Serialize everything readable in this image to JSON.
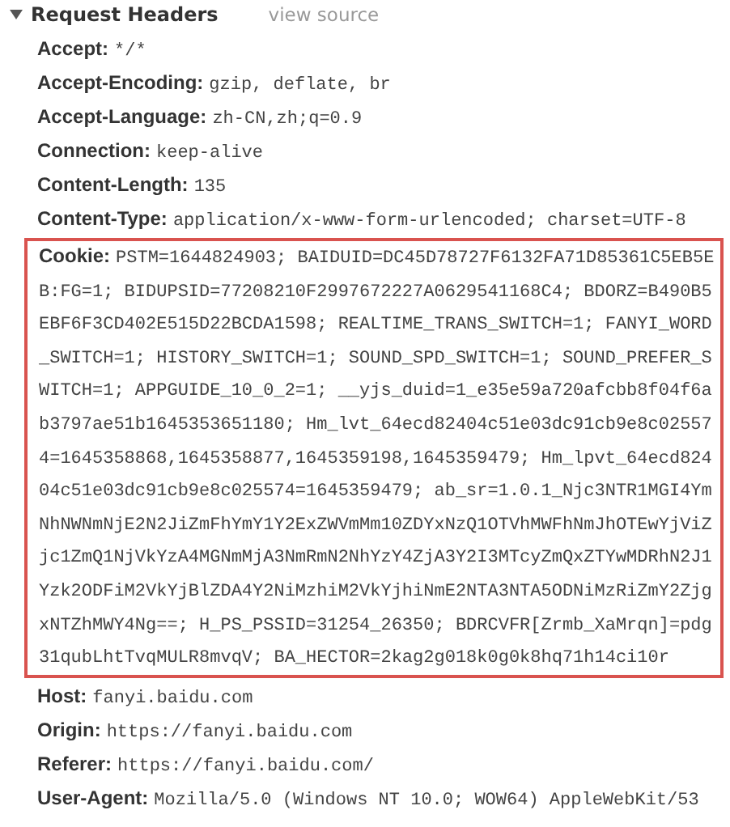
{
  "section": {
    "title": "Request Headers",
    "expanded": true,
    "link": "view source"
  },
  "headers": [
    {
      "name": "Accept:",
      "value": "*/*",
      "highlighted": false
    },
    {
      "name": "Accept-Encoding:",
      "value": "gzip, deflate, br",
      "highlighted": false
    },
    {
      "name": "Accept-Language:",
      "value": "zh-CN,zh;q=0.9",
      "highlighted": false
    },
    {
      "name": "Connection:",
      "value": "keep-alive",
      "highlighted": false
    },
    {
      "name": "Content-Length:",
      "value": "135",
      "highlighted": false
    },
    {
      "name": "Content-Type:",
      "value": "application/x-www-form-urlencoded; charset=UTF-8",
      "highlighted": false
    },
    {
      "name": "Cookie:",
      "value": "PSTM=1644824903; BAIDUID=DC45D78727F6132FA71D85361C5EB5EB:FG=1; BIDUPSID=77208210F2997672227A0629541168C4; BDORZ=B490B5EBF6F3CD402E515D22BCDA1598; REALTIME_TRANS_SWITCH=1; FANYI_WORD_SWITCH=1; HISTORY_SWITCH=1; SOUND_SPD_SWITCH=1; SOUND_PREFER_SWITCH=1; APPGUIDE_10_0_2=1; __yjs_duid=1_e35e59a720afcbb8f04f6ab3797ae51b1645353651180; Hm_lvt_64ecd82404c51e03dc91cb9e8c025574=1645358868,1645358877,1645359198,1645359479; Hm_lpvt_64ecd82404c51e03dc91cb9e8c025574=1645359479; ab_sr=1.0.1_Njc3NTR1MGI4YmNhNWNmNjE2N2JiZmFhYmY1Y2ExZWVmMm10ZDYxNzQ1OTVhMWFhNmJhOTEwYjViZjc1ZmQ1NjVkYzA4MGNmMjA3NmRmN2NhYzY4ZjA3Y2I3MTcyZmQxZTYwMDRhN2J1Yzk2ODFiM2VkYjBlZDA4Y2NiMzhiM2VkYjhiNmE2NTA3NTA5ODNiMzRiZmY2ZjgxNTZhMWY4Ng==; H_PS_PSSID=31254_26350; BDRCVFR[Zrmb_XaMrqn]=pdg31qubLhtTvqMULR8mvqV; BA_HECTOR=2kag2g018k0g0k8hq71h14ci10r",
      "highlighted": true
    },
    {
      "name": "Host:",
      "value": "fanyi.baidu.com",
      "highlighted": false
    },
    {
      "name": "Origin:",
      "value": "https://fanyi.baidu.com",
      "highlighted": false
    },
    {
      "name": "Referer:",
      "value": "https://fanyi.baidu.com/",
      "highlighted": false
    },
    {
      "name": "User-Agent:",
      "value": "Mozilla/5.0 (Windows NT 10.0; WOW64) AppleWebKit/53",
      "highlighted": false
    }
  ]
}
